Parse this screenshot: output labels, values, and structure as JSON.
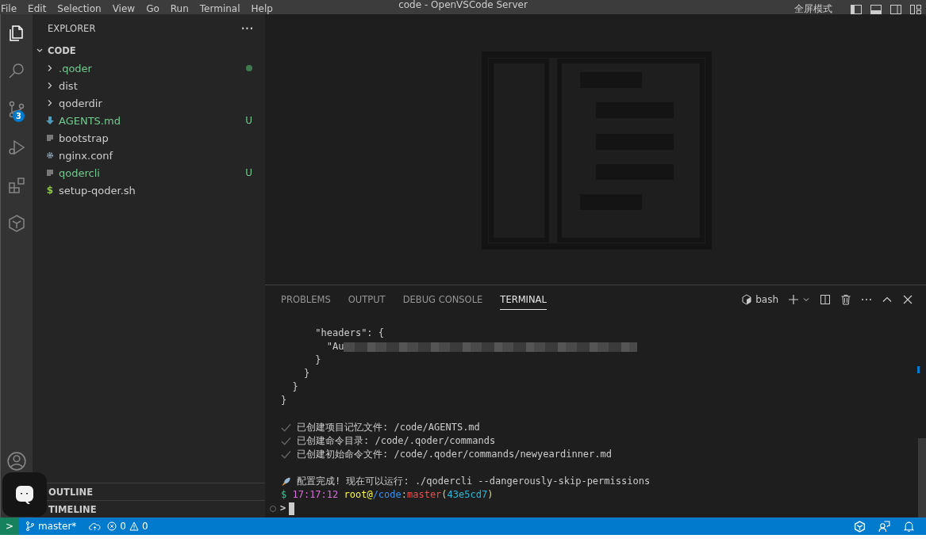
{
  "window": {
    "title": "code - OpenVSCode Server",
    "fullscreen_label": "全屏模式"
  },
  "menu": [
    "File",
    "Edit",
    "Selection",
    "View",
    "Go",
    "Run",
    "Terminal",
    "Help"
  ],
  "activity_bar": [
    {
      "kind": "explorer",
      "selected": true
    },
    {
      "kind": "search",
      "selected": false
    },
    {
      "kind": "source-control",
      "selected": false,
      "badge": "3"
    },
    {
      "kind": "run-debug",
      "selected": false
    },
    {
      "kind": "extensions",
      "selected": false
    },
    {
      "kind": "qoder",
      "selected": false
    }
  ],
  "sidebar": {
    "title": "EXPLORER",
    "more": "···",
    "root": {
      "label": "CODE",
      "expanded": true
    },
    "items": [
      {
        "name": ".qoder",
        "kind": "folder",
        "expanded": false,
        "modified": true
      },
      {
        "name": "dist",
        "kind": "folder",
        "expanded": false,
        "modified": false
      },
      {
        "name": "qoderdir",
        "kind": "folder",
        "expanded": false,
        "modified": false
      },
      {
        "name": "AGENTS.md",
        "kind": "markdown",
        "modified": false,
        "badge": "U"
      },
      {
        "name": "bootstrap",
        "kind": "text",
        "modified": false
      },
      {
        "name": "nginx.conf",
        "kind": "config",
        "modified": false
      },
      {
        "name": "qodercli",
        "kind": "text",
        "modified": false,
        "badge": "U"
      },
      {
        "name": "setup-qoder.sh",
        "kind": "shell",
        "glyph": "$",
        "modified": false
      }
    ],
    "sections": [
      {
        "label": "OUTLINE"
      },
      {
        "label": "TIMELINE"
      }
    ]
  },
  "panel": {
    "tabs": [
      {
        "label": "PROBLEMS",
        "selected": false
      },
      {
        "label": "OUTPUT",
        "selected": false
      },
      {
        "label": "DEBUG CONSOLE",
        "selected": false
      },
      {
        "label": "TERMINAL",
        "selected": true
      }
    ],
    "shell": "bash",
    "lines": [
      {
        "kind": "text",
        "text": "      \"headers\": {"
      },
      {
        "kind": "redacted",
        "text": "        \"Au"
      },
      {
        "kind": "text",
        "text": "      }"
      },
      {
        "kind": "text",
        "text": "    }"
      },
      {
        "kind": "text",
        "text": "  }"
      },
      {
        "kind": "text",
        "text": "}"
      },
      {
        "kind": "blank"
      },
      {
        "kind": "check",
        "text": "已创建项目记忆文件: /code/AGENTS.md"
      },
      {
        "kind": "check",
        "text": "已创建命令目录: /code/.qoder/commands"
      },
      {
        "kind": "check",
        "text": "已创建初始命令文件: /code/.qoder/commands/newyeardinner.md"
      },
      {
        "kind": "blank"
      },
      {
        "kind": "rocket",
        "text": "配置完成! 现在可以运行: ./qodercli --dangerously-skip-permissions"
      },
      {
        "kind": "prompt",
        "segments": [
          {
            "text": "$",
            "color": "#23d18b"
          },
          {
            "text": "17:17:12",
            "color": "#d670d6"
          },
          {
            "text": "root@",
            "color": "#f5f543"
          },
          {
            "text": "/code",
            "color": "#3b8eea"
          },
          {
            "text": ":"
          },
          {
            "text": "master",
            "color": "#f14c4c"
          },
          {
            "text": "("
          },
          {
            "text": "43e5cd7",
            "color": "#29b8db"
          },
          {
            "text": ")"
          }
        ]
      },
      {
        "kind": "input",
        "prompt": ">"
      }
    ]
  },
  "status_bar": {
    "remote": ">",
    "branch": "master*",
    "errors": "0",
    "warnings": "0"
  }
}
